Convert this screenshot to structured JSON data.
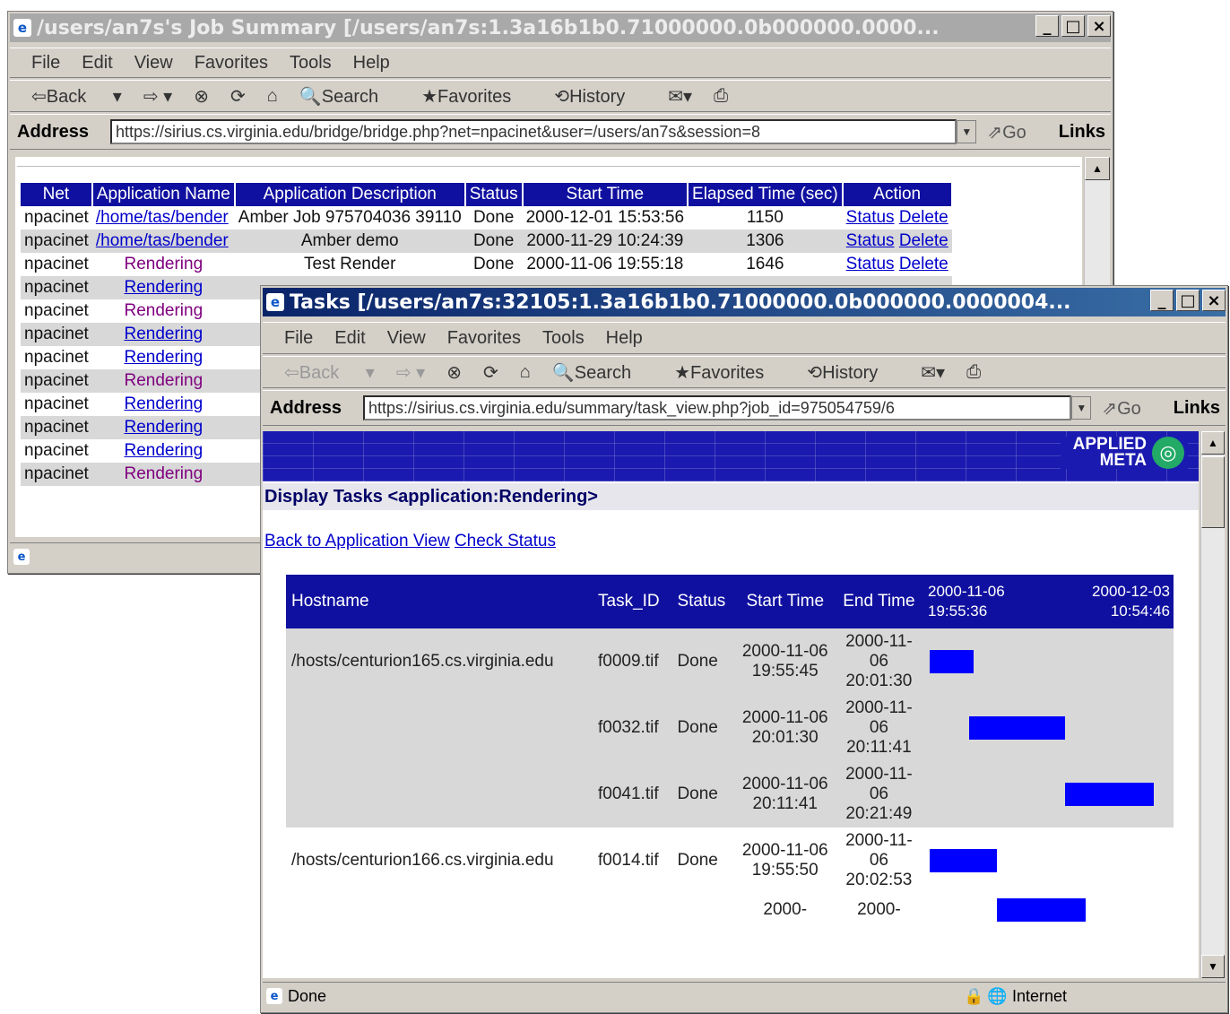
{
  "window1": {
    "title": "/users/an7s's Job Summary [/users/an7s:1.3a16b1b0.71000000.0b000000.0000...",
    "menu": [
      "File",
      "Edit",
      "View",
      "Favorites",
      "Tools",
      "Help"
    ],
    "toolbar": [
      "Back",
      "Search",
      "Favorites",
      "History"
    ],
    "address_label": "Address",
    "address": "https://sirius.cs.virginia.edu/bridge/bridge.php?net=npacinet&user=/users/an7s&session=8",
    "go": "Go",
    "links": "Links",
    "columns": [
      "Net",
      "Application Name",
      "Application Description",
      "Status",
      "Start Time",
      "Elapsed Time (sec)",
      "Action"
    ],
    "rows": [
      {
        "net": "npacinet",
        "app": "/home/tas/bender",
        "desc": "Amber Job 975704036 39110",
        "status": "Done",
        "start": "2000-12-01 15:53:56",
        "elapsed": "1150",
        "status_link": "Status",
        "delete_link": "Delete"
      },
      {
        "net": "npacinet",
        "app": "/home/tas/bender",
        "desc": "Amber demo",
        "status": "Done",
        "start": "2000-11-29 10:24:39",
        "elapsed": "1306",
        "status_link": "Status",
        "delete_link": "Delete"
      },
      {
        "net": "npacinet",
        "app": "Rendering",
        "desc": "Test Render",
        "status": "Done",
        "start": "2000-11-06 19:55:18",
        "elapsed": "1646",
        "status_link": "Status",
        "delete_link": "Delete"
      },
      {
        "net": "npacinet",
        "app": "Rendering"
      },
      {
        "net": "npacinet",
        "app": "Rendering"
      },
      {
        "net": "npacinet",
        "app": "Rendering"
      },
      {
        "net": "npacinet",
        "app": "Rendering"
      },
      {
        "net": "npacinet",
        "app": "Rendering"
      },
      {
        "net": "npacinet",
        "app": "Rendering"
      },
      {
        "net": "npacinet",
        "app": "Rendering"
      },
      {
        "net": "npacinet",
        "app": "Rendering"
      },
      {
        "net": "npacinet",
        "app": "Rendering"
      }
    ]
  },
  "window2": {
    "title": "Tasks [/users/an7s:32105:1.3a16b1b0.71000000.0b000000.0000004...",
    "menu": [
      "File",
      "Edit",
      "View",
      "Favorites",
      "Tools",
      "Help"
    ],
    "toolbar": [
      "Back",
      "Search",
      "Favorites",
      "History"
    ],
    "address_label": "Address",
    "address": "https://sirius.cs.virginia.edu/summary/task_view.php?job_id=975054759/6",
    "go": "Go",
    "links": "Links",
    "brand": "APPLIED META",
    "heading": "Display Tasks <application:Rendering>",
    "nav_back": "Back to Application View",
    "nav_check": "Check Status",
    "columns": [
      "Hostname",
      "Task_ID",
      "Status",
      "Start Time",
      "End Time"
    ],
    "range_start": "2000-11-06 19:55:36",
    "range_end": "2000-12-03 10:54:46",
    "rows": [
      {
        "host": "/hosts/centurion165.cs.virginia.edu",
        "task": "f0009.tif",
        "status": "Done",
        "start": "2000-11-06 19:55:45",
        "end": "2000-11-06 20:01:30",
        "bar_start": 0.0,
        "bar_end": 0.19
      },
      {
        "host": "",
        "task": "f0032.tif",
        "status": "Done",
        "start": "2000-11-06 20:01:30",
        "end": "2000-11-06 20:11:41",
        "bar_start": 0.17,
        "bar_end": 0.58
      },
      {
        "host": "",
        "task": "f0041.tif",
        "status": "Done",
        "start": "2000-11-06 20:11:41",
        "end": "2000-11-06 20:21:49",
        "bar_start": 0.58,
        "bar_end": 0.96
      },
      {
        "host": "/hosts/centurion166.cs.virginia.edu",
        "task": "f0014.tif",
        "status": "Done",
        "start": "2000-11-06 19:55:50",
        "end": "2000-11-06 20:02:53",
        "bar_start": 0.0,
        "bar_end": 0.29
      },
      {
        "host": "",
        "task": "",
        "status": "",
        "start": "2000-",
        "end": "2000-",
        "bar_start": 0.29,
        "bar_end": 0.67
      }
    ],
    "status_text": "Done",
    "zone": "Internet"
  }
}
